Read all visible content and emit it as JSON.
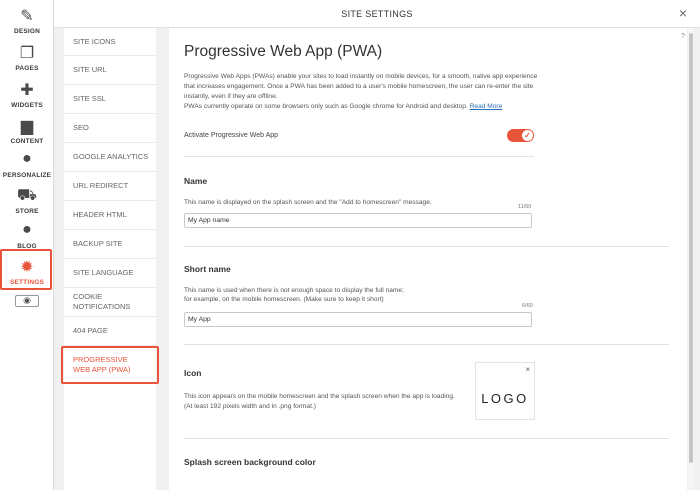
{
  "modal": {
    "title": "SITE SETTINGS",
    "close": "×",
    "help": "?"
  },
  "rail": {
    "items": [
      {
        "label": "DESIGN",
        "icon": "✎"
      },
      {
        "label": "PAGES",
        "icon": "❐"
      },
      {
        "label": "WIDGETS",
        "icon": "✚"
      },
      {
        "label": "CONTENT",
        "icon": "▆"
      },
      {
        "label": "PERSONALIZE",
        "icon": "●"
      },
      {
        "label": "STORE",
        "icon": "⛟"
      },
      {
        "label": "BLOG",
        "icon": "●"
      },
      {
        "label": "SETTINGS",
        "icon": "✹"
      }
    ],
    "eye_icon": "◉"
  },
  "nav": {
    "items": [
      "SITE ICONS",
      "SITE URL",
      "SITE SSL",
      "SEO",
      "GOOGLE ANALYTICS",
      "URL REDIRECT",
      "HEADER HTML",
      "BACKUP SITE",
      "SITE LANGUAGE",
      "COOKIE NOTIFICATIONS",
      "404 PAGE",
      "PROGRESSIVE WEB APP (PWA)"
    ]
  },
  "pwa": {
    "title": "Progressive Web App (PWA)",
    "intro": "Progressive Web Apps (PWAs) enable your sites to load instantly on mobile devices, for a smooth, native app experience that increases engagement. Once a PWA has been added to a user's mobile homescreen, the user can re-enter the site instantly, even if they are offline.",
    "intro2": "PWAs currently operate on some browsers only such as Google chrome for Android and desktop.",
    "read_more": "Read More",
    "activate_label": "Activate Progressive Web App",
    "toggle_check": "✓",
    "name": {
      "title": "Name",
      "desc": "This name is displayed on the splash screen and the \"Add to homescreen\" message.",
      "count": "11/60",
      "value": "My App name"
    },
    "short_name": {
      "title": "Short name",
      "desc1": "This name is used when there is not enough space to display the full name;",
      "desc2": "for example, on the mobile homescreen. (Make sure to keep it short)",
      "count": "6/60",
      "value": "My App"
    },
    "icon": {
      "title": "Icon",
      "desc": "This icon appears on the mobile homescreen and the splash screen when the app is loading. (At least 192 pixels width and in .png format.)",
      "logo_text": "LOGO",
      "remove": "×"
    },
    "splash": {
      "title": "Splash screen background color"
    }
  },
  "colors": {
    "accent": "#e8543a",
    "link": "#2a6fb6"
  }
}
